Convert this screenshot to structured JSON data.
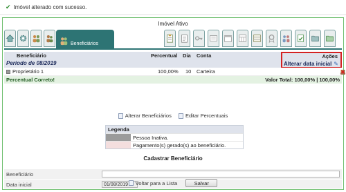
{
  "alert": {
    "icon": "check-icon",
    "message": "Imóvel alterado com sucesso."
  },
  "status_title": "Imóvel Ativo",
  "tabs": {
    "active_label": "Beneficiários",
    "left_icons": [
      "home-icon",
      "gear-icon",
      "people-icon"
    ],
    "right_icons": [
      "clipboard-icon",
      "document-icon",
      "key-icon",
      "list-icon",
      "calendar-icon",
      "calendar-grid-icon",
      "table-icon",
      "ribbon-icon",
      "people-group-icon",
      "document-check-icon",
      "folder-icon"
    ]
  },
  "grid": {
    "headers": {
      "beneficiario": "Beneficiário",
      "percentual": "Percentual",
      "dia": "Dia",
      "conta": "Conta",
      "acoes": "Ações"
    },
    "period": "Período de 08/2019",
    "alterar_data": "Alterar data inicial",
    "rows": [
      {
        "beneficiario": "Proprietário 1",
        "percentual": "100,00%",
        "dia": "10",
        "conta": "Carteira"
      }
    ],
    "status_ok": "Percentual Correto!",
    "total": "Valor Total: 100,00% | 100,00%"
  },
  "links": {
    "alterar": "Alterar Beneficiários",
    "editar": "Editar Percentuais"
  },
  "legend": {
    "title": "Legenda",
    "items": [
      {
        "color": "#9b9b9b",
        "label": "Pessoa Inativa."
      },
      {
        "color": "#f4dede",
        "label": "Pagamento(s) gerado(s) ao beneficiário."
      }
    ]
  },
  "form": {
    "section_title": "Cadastrar Beneficiário",
    "beneficiario_label": "Beneficiário",
    "beneficiario_value": "",
    "data_label": "Data inicial",
    "data_value": "01/08/2019"
  },
  "footer": {
    "voltar": "Voltar para a Lista",
    "salvar": "Salvar"
  },
  "colors": {
    "accent": "#2d7474",
    "frame": "#6fbf6f",
    "highlight": "#d42222"
  }
}
